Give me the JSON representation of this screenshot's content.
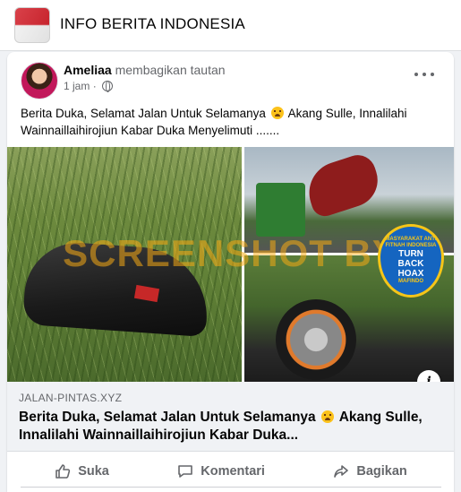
{
  "header": {
    "page_name": "INFO BERITA INDONESIA"
  },
  "post": {
    "author": "Ameliaa",
    "action": "membagikan tautan",
    "time": "1 jam",
    "text_before_emoji": "Berita Duka, Selamat Jalan Untuk Selamanya",
    "text_after_emoji": "Akang Sulle, Innalilahi Wainnaillaihirojiun Kabar Duka Menyelimuti .......",
    "emoji": "weeping-face",
    "media": {
      "watermark": "SCREENSHOT BY",
      "badge_lines": [
        "MASYARAKAT ANTI FITNAH INDONESIA",
        "TURN",
        "BACK",
        "HOAX",
        "MAFINDO"
      ]
    },
    "link": {
      "domain": "JALAN-PINTAS.XYZ",
      "title_before_emoji": "Berita Duka, Selamat Jalan Untuk Selamanya",
      "title_after_emoji": "Akang Sulle, Innalilahi Wainnaillaihirojiun Kabar Duka..."
    },
    "actions": {
      "like": "Suka",
      "comment": "Komentari",
      "share": "Bagikan"
    }
  },
  "colors": {
    "background": "#f0f2f5",
    "secondary_text": "#65676b",
    "watermark": "#f5aa14",
    "badge_blue": "#1565c0"
  }
}
